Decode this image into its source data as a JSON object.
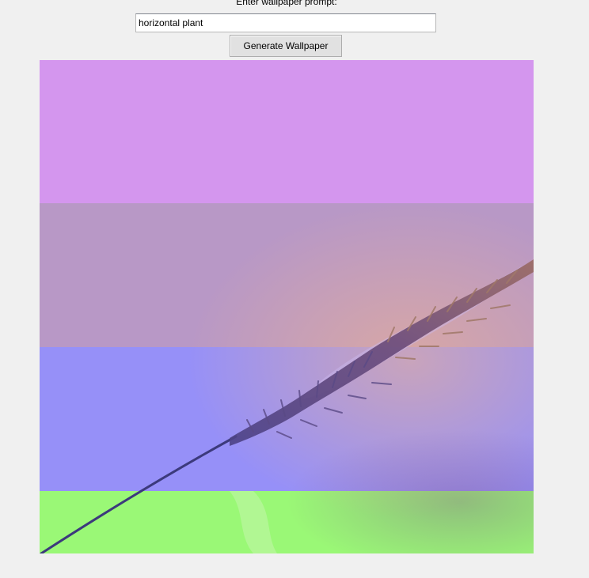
{
  "prompt": {
    "label": "Enter wallpaper prompt:",
    "value": "horizontal plant"
  },
  "generate_button": {
    "label": "Generate Wallpaper"
  },
  "wallpaper": {
    "band_colors": [
      "#d496ee",
      "#b898c6",
      "#9690f8",
      "#9af876"
    ]
  }
}
